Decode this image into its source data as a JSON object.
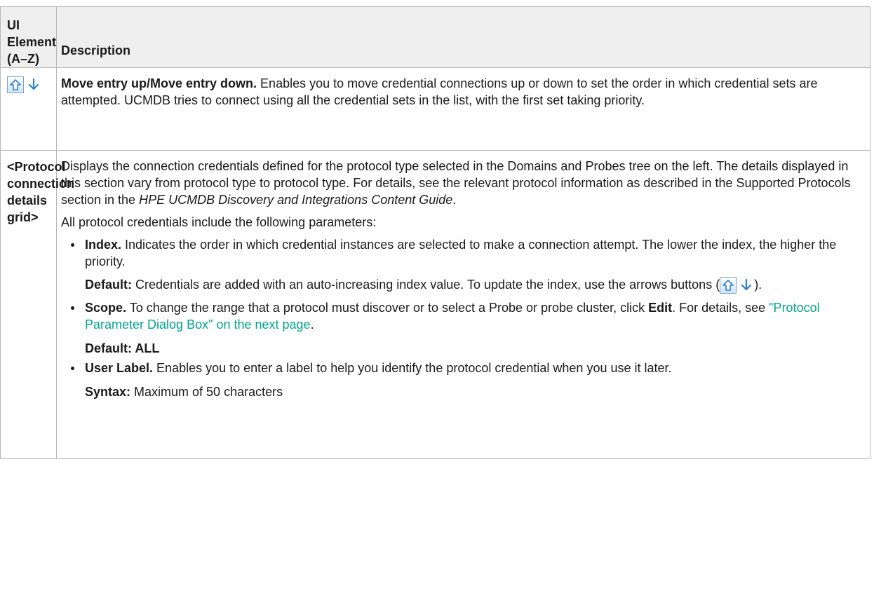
{
  "header": {
    "col1": "UI Element (A–Z)",
    "col2": "Description"
  },
  "row1": {
    "icons": [
      "move-up-icon",
      "move-down-icon"
    ],
    "title": "Move entry up/Move entry down.",
    "text": " Enables you to move credential connections up or down to set the order in which credential sets are attempted. UCMDB tries to connect using all the credential sets in the list, with the first set taking priority."
  },
  "row2": {
    "element": "<Protocol connection details grid>",
    "p1_a": "Displays the connection credentials defined for the protocol type selected in the Domains and Probes tree on the left. The details displayed in this section vary from protocol type to protocol type. For details, see the relevant protocol information as described in the Supported Protocols section in the ",
    "p1_guide": "HPE UCMDB Discovery and Integrations Content Guide",
    "p1_end": ".",
    "p2": "All protocol credentials include the following parameters:",
    "index_label": "Index.",
    "index_text": " Indicates the order in which credential instances are selected to make a connection attempt. The lower the index, the higher the priority.",
    "index_default_label": "Default:",
    "index_default_text": " Credentials are added with an auto-increasing index value. To update the index, use the arrows buttons (",
    "index_default_close": ").",
    "scope_label": "Scope.",
    "scope_text": " To change the range that a protocol must discover or to select a Probe or probe cluster, click ",
    "scope_edit": "Edit",
    "scope_text2": ". For details, see ",
    "scope_link": "\"Protocol Parameter Dialog Box\" on the next page",
    "scope_end": ".",
    "scope_default": "Default: ALL",
    "user_label": "User Label.",
    "user_text": " Enables you to enter a label to help you identify the protocol credential when you use it later.",
    "syntax_label": "Syntax:",
    "syntax_text": " Maximum of 50 characters"
  },
  "colors": {
    "header_bg": "#efefef",
    "border": "#b7b7b7",
    "link": "#00a58a",
    "icon_blue": "#2b7fd0"
  }
}
